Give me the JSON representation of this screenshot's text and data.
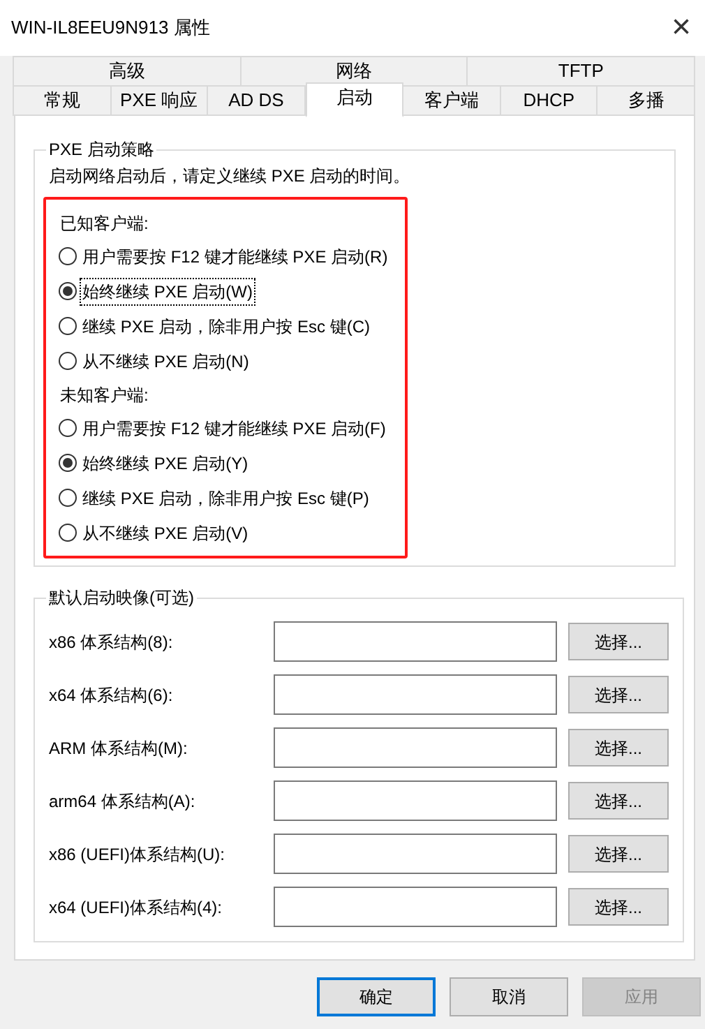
{
  "window": {
    "title": "WIN-IL8EEU9N913 属性",
    "close": "×"
  },
  "tab_rows": [
    [
      {
        "label": "高级",
        "selected": false
      },
      {
        "label": "网络",
        "selected": false
      },
      {
        "label": "TFTP",
        "selected": false
      }
    ],
    [
      {
        "label": "常规",
        "selected": false
      },
      {
        "label": "PXE 响应",
        "selected": false
      },
      {
        "label": "AD DS",
        "selected": false
      },
      {
        "label": "启动",
        "selected": true
      },
      {
        "label": "客户端",
        "selected": false
      },
      {
        "label": "DHCP",
        "selected": false
      },
      {
        "label": "多播",
        "selected": false
      }
    ]
  ],
  "boot_policy": {
    "title": "PXE 启动策略",
    "description": "启动网络启动后，请定义继续 PXE 启动的时间。",
    "highlighted": true,
    "groups": [
      {
        "label": "已知客户端:",
        "options": [
          {
            "label": "用户需要按 F12 键才能继续 PXE 启动(R)",
            "selected": false,
            "focused": false
          },
          {
            "label": "始终继续 PXE 启动(W)",
            "selected": true,
            "focused": true
          },
          {
            "label": "继续 PXE 启动，除非用户按 Esc 键(C)",
            "selected": false,
            "focused": false
          },
          {
            "label": "从不继续 PXE 启动(N)",
            "selected": false,
            "focused": false
          }
        ]
      },
      {
        "label": "未知客户端:",
        "options": [
          {
            "label": "用户需要按 F12 键才能继续 PXE 启动(F)",
            "selected": false,
            "focused": false
          },
          {
            "label": "始终继续 PXE 启动(Y)",
            "selected": true,
            "focused": false
          },
          {
            "label": "继续 PXE 启动，除非用户按 Esc 键(P)",
            "selected": false,
            "focused": false
          },
          {
            "label": "从不继续 PXE 启动(V)",
            "selected": false,
            "focused": false
          }
        ]
      }
    ]
  },
  "boot_images": {
    "title": "默认启动映像(可选)",
    "rows": [
      {
        "label": "x86 体系结构(8):",
        "button": "选择..."
      },
      {
        "label": "x64 体系结构(6):",
        "button": "选择..."
      },
      {
        "label": "ARM 体系结构(M):",
        "button": "选择..."
      },
      {
        "label": "arm64 体系结构(A):",
        "button": "选择..."
      },
      {
        "label": "x86 (UEFI)体系结构(U):",
        "button": "选择..."
      },
      {
        "label": "x64 (UEFI)体系结构(4):",
        "button": "选择..."
      }
    ]
  },
  "buttons": [
    {
      "label": "确定",
      "default": true,
      "disabled": false
    },
    {
      "label": "取消",
      "default": false,
      "disabled": false
    },
    {
      "label": "应用",
      "default": false,
      "disabled": true
    }
  ]
}
